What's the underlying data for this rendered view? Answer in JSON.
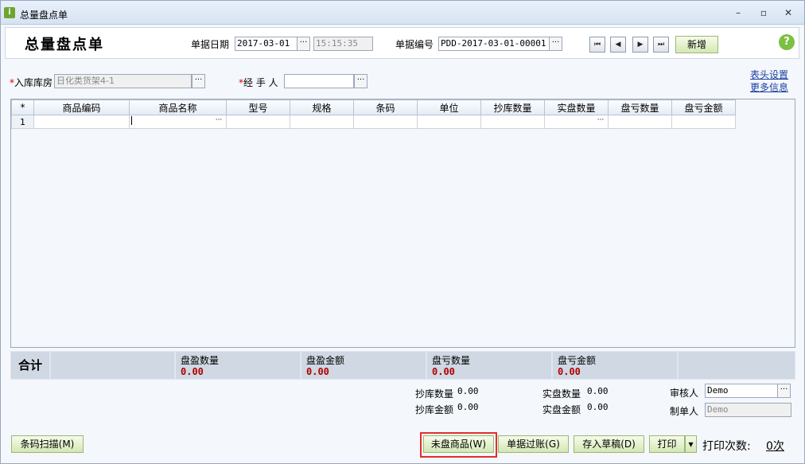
{
  "window": {
    "title": "总量盘点单",
    "minimize": "–",
    "restore": "▫",
    "close": "✕"
  },
  "header": {
    "doc_title": "总量盘点单",
    "date_label": "单据日期",
    "date_value": "2017-03-01",
    "time_value": "15:15:35",
    "number_label": "单据编号",
    "number_value": "PDD-2017-03-01-00001",
    "nav": [
      "⏮",
      "◀",
      "▶",
      "⏭"
    ],
    "new_button": "新增",
    "help": "?"
  },
  "form": {
    "warehouse_label": "入库库房",
    "warehouse_value": "日化类货架4-1",
    "handler_label": "经 手 人",
    "handler_value": "",
    "required_mark": "*",
    "header_settings_link": "表头设置",
    "more_info_link": "更多信息",
    "ellipsis": "···"
  },
  "grid": {
    "corner": "*",
    "columns": [
      "商品编码",
      "商品名称",
      "型号",
      "规格",
      "条码",
      "单位",
      "抄库数量",
      "实盘数量",
      "盘亏数量",
      "盘亏金额"
    ],
    "rows": [
      {
        "index": "1",
        "cells": [
          "",
          "",
          "",
          "",
          "",
          "",
          "",
          "",
          "",
          ""
        ]
      }
    ]
  },
  "totals": {
    "label": "合计",
    "items": [
      {
        "title": "盘盈数量",
        "value": "0.00"
      },
      {
        "title": "盘盈金额",
        "value": "0.00"
      },
      {
        "title": "盘亏数量",
        "value": "0.00"
      },
      {
        "title": "盘亏金额",
        "value": "0.00"
      }
    ]
  },
  "summary": {
    "book_qty_label": "抄库数量",
    "book_qty_value": "0.00",
    "actual_qty_label": "实盘数量",
    "actual_qty_value": "0.00",
    "book_amt_label": "抄库金额",
    "book_amt_value": "0.00",
    "actual_amt_label": "实盘金额",
    "actual_amt_value": "0.00",
    "auditor_label": "审核人",
    "auditor_value": "Demo",
    "maker_label": "制单人",
    "maker_value": "Demo"
  },
  "footer": {
    "barcode_scan": "条码扫描(M)",
    "uncounted_goods": "未盘商品(W)",
    "post_document": "单据过账(G)",
    "save_draft": "存入草稿(D)",
    "print": "打印",
    "print_dropdown": "▾",
    "print_count_label": "打印次数:",
    "print_count_value": "0次"
  }
}
